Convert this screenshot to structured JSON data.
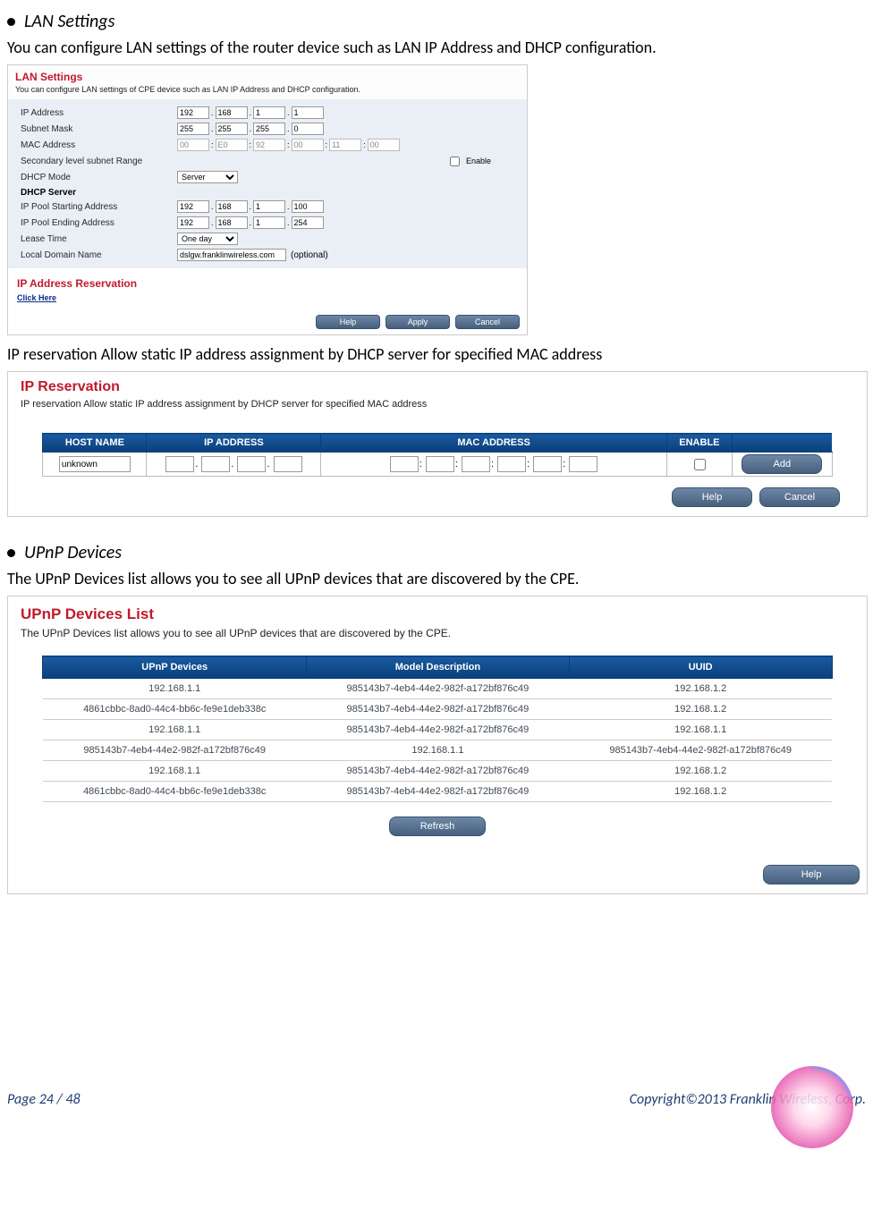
{
  "sec1": {
    "heading": "LAN Settings",
    "intro": "You can configure LAN settings of the router device such as LAN IP Address and DHCP configuration.",
    "panel": {
      "title": "LAN Settings",
      "desc": "You can configure LAN settings of CPE device such as LAN IP Address and DHCP configuration.",
      "lbl_ip": "IP Address",
      "ip": [
        "192",
        "168",
        "1",
        "1"
      ],
      "lbl_mask": "Subnet Mask",
      "mask": [
        "255",
        "255",
        "255",
        "0"
      ],
      "lbl_mac": "MAC Address",
      "mac": [
        "00",
        "E0",
        "92",
        "00",
        "11",
        "00"
      ],
      "lbl_sec": "Secondary level subnet Range",
      "enable_lbl": "Enable",
      "lbl_dhcpmode": "DHCP Mode",
      "dhcpmode": "Server",
      "dhcp_head": "DHCP Server",
      "lbl_start": "IP Pool Starting Address",
      "start": [
        "192",
        "168",
        "1",
        "100"
      ],
      "lbl_end": "IP Pool Ending Address",
      "end": [
        "192",
        "168",
        "1",
        "254"
      ],
      "lbl_lease": "Lease Time",
      "lease": "One day",
      "lbl_domain": "Local Domain Name",
      "domain": "dslgw.franklinwireless.com",
      "optional": "(optional)",
      "res_title": "IP Address Reservation",
      "click_here": "Click Here",
      "btn_help": "Help",
      "btn_apply": "Apply",
      "btn_cancel": "Cancel"
    },
    "ipres_intro": "IP reservation Allow static IP address assignment by DHCP server for specified MAC address"
  },
  "panel2": {
    "title": "IP Reservation",
    "desc": "IP reservation Allow static IP address assignment by DHCP server for specified MAC address",
    "th_host": "HOST NAME",
    "th_ip": "IP ADDRESS",
    "th_mac": "MAC ADDRESS",
    "th_en": "ENABLE",
    "hostname": "unknown",
    "btn_add": "Add",
    "btn_help": "Help",
    "btn_cancel": "Cancel"
  },
  "sec2": {
    "heading": "UPnP Devices",
    "intro": "The UPnP Devices list allows you to see all UPnP devices that are discovered by the CPE."
  },
  "panel3": {
    "title": "UPnP Devices List",
    "desc": "The UPnP Devices list allows you to see all UPnP devices that are discovered by the CPE.",
    "th_dev": "UPnP Devices",
    "th_model": "Model Description",
    "th_uuid": "UUID",
    "chart_data": {
      "type": "table",
      "columns": [
        "UPnP Devices",
        "Model Description",
        "UUID"
      ],
      "rows": [
        [
          "192.168.1.1",
          "985143b7-4eb4-44e2-982f-a172bf876c49",
          "192.168.1.2"
        ],
        [
          "4861cbbc-8ad0-44c4-bb6c-fe9e1deb338c",
          "985143b7-4eb4-44e2-982f-a172bf876c49",
          "192.168.1.2"
        ],
        [
          "192.168.1.1",
          "985143b7-4eb4-44e2-982f-a172bf876c49",
          "192.168.1.1"
        ],
        [
          "985143b7-4eb4-44e2-982f-a172bf876c49",
          "192.168.1.1",
          "985143b7-4eb4-44e2-982f-a172bf876c49"
        ],
        [
          "192.168.1.1",
          "985143b7-4eb4-44e2-982f-a172bf876c49",
          "192.168.1.2"
        ],
        [
          "4861cbbc-8ad0-44c4-bb6c-fe9e1deb338c",
          "985143b7-4eb4-44e2-982f-a172bf876c49",
          "192.168.1.2"
        ]
      ]
    },
    "btn_refresh": "Refresh",
    "btn_help": "Help"
  },
  "footer": {
    "page": "Page  24  /  48",
    "copyright": "Copyright©2013  Franklin  Wireless, Corp."
  }
}
